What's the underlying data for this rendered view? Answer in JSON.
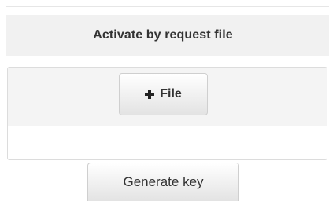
{
  "activation": {
    "title": "Activate by request file"
  },
  "file_panel": {
    "file_button_label": "File",
    "file_button_icon": "plus-icon"
  },
  "actions": {
    "generate_label": "Generate key"
  }
}
